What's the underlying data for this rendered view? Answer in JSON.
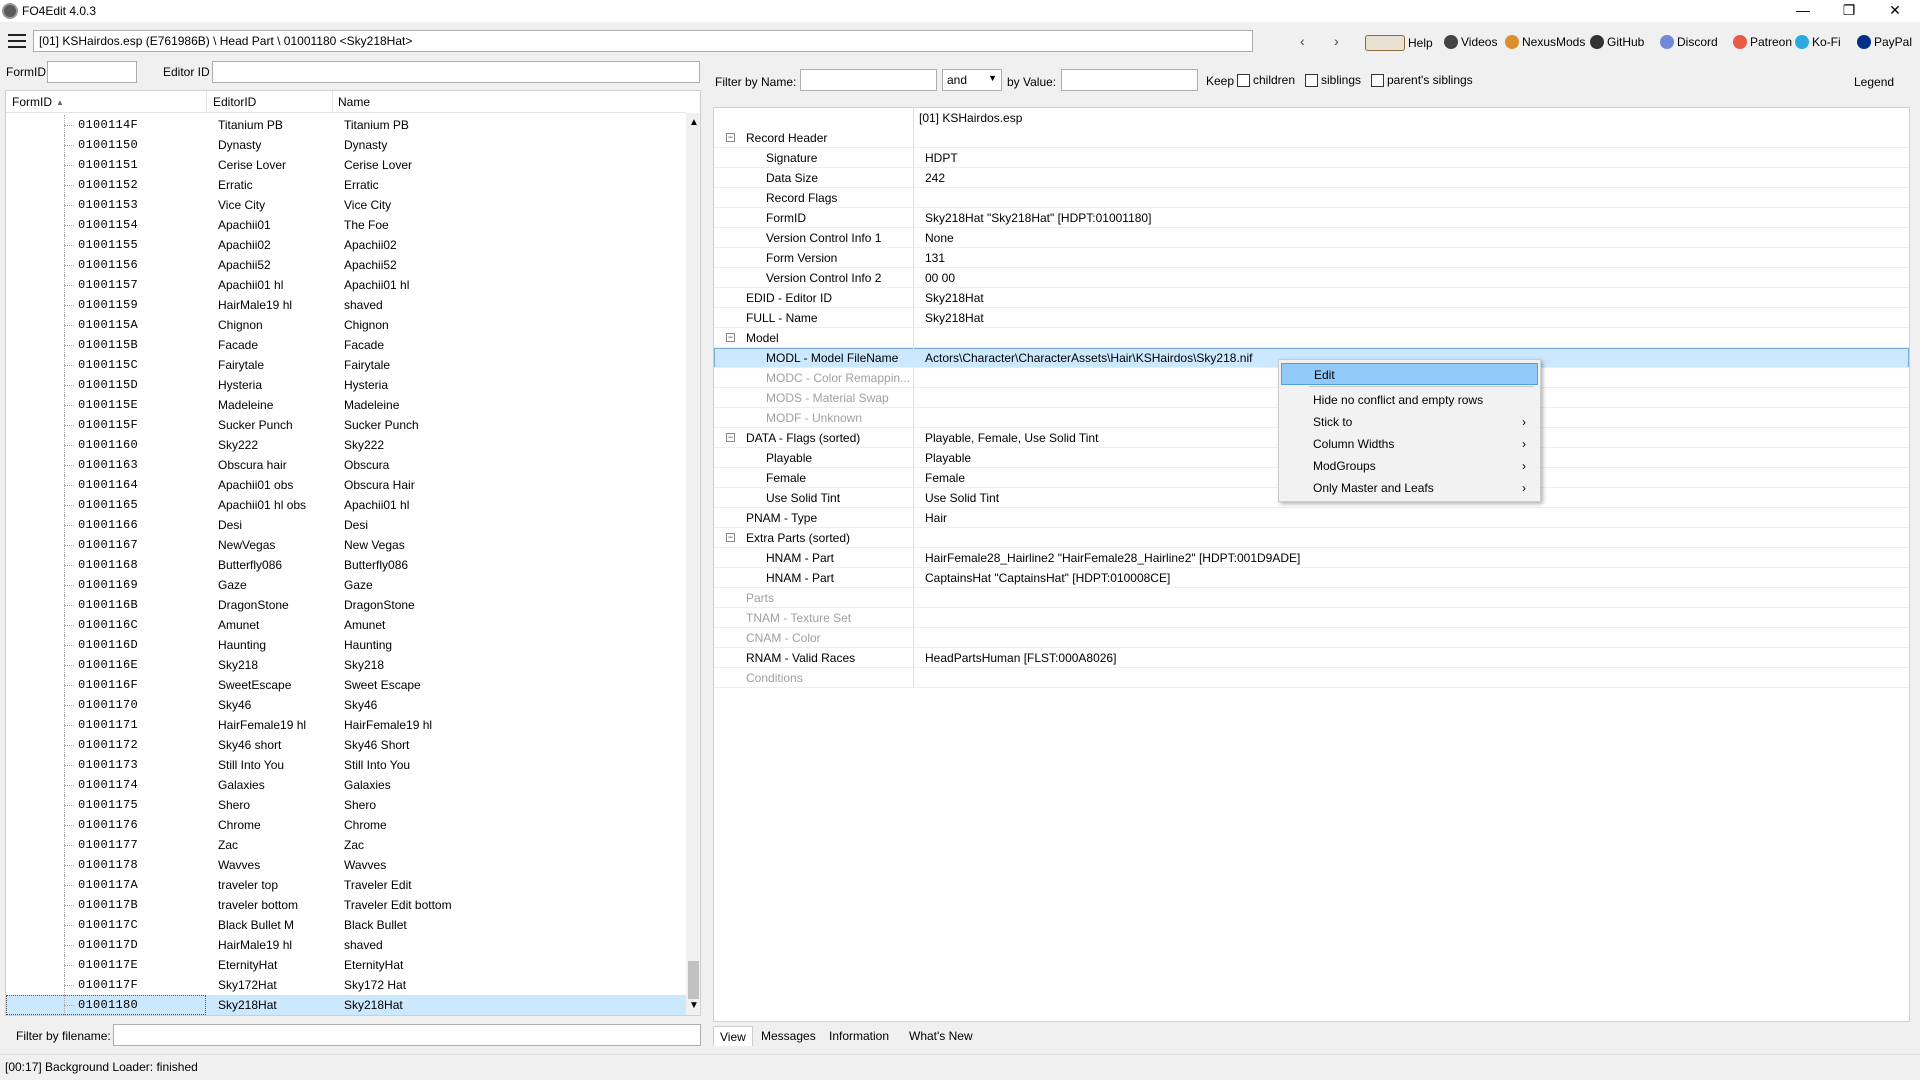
{
  "window": {
    "title": "FO4Edit 4.0.3",
    "minimize": "—",
    "maximize": "❐",
    "close": "✕"
  },
  "toolbar": {
    "path": "[01] KSHairdos.esp (E761986B) \\ Head Part \\ 01001180 <Sky218Hat>",
    "back": "‹",
    "forward": "›",
    "links": [
      {
        "label": "Help",
        "icon": "book-icon",
        "color": "#8a6a3a"
      },
      {
        "label": "Videos",
        "icon": "video-icon",
        "color": "#444"
      },
      {
        "label": "NexusMods",
        "icon": "nexusmods-icon",
        "color": "#d98f2b"
      },
      {
        "label": "GitHub",
        "icon": "github-icon",
        "color": "#333"
      },
      {
        "label": "Discord",
        "icon": "discord-icon",
        "color": "#7289da"
      },
      {
        "label": "Patreon",
        "icon": "patreon-icon",
        "color": "#e85b46"
      },
      {
        "label": "Ko-Fi",
        "icon": "kofi-icon",
        "color": "#29abe0"
      },
      {
        "label": "PayPal",
        "icon": "paypal-icon",
        "color": "#003087"
      }
    ]
  },
  "left": {
    "formid_label": "FormID",
    "editorid_label": "Editor ID",
    "columns": [
      "FormID",
      "EditorID",
      "Name"
    ],
    "sort_arrow": "▲",
    "rows": [
      [
        "0100114F",
        "Titanium PB",
        "Titanium PB"
      ],
      [
        "01001150",
        "Dynasty",
        "Dynasty"
      ],
      [
        "01001151",
        "Cerise Lover",
        "Cerise Lover"
      ],
      [
        "01001152",
        "Erratic",
        "Erratic"
      ],
      [
        "01001153",
        "Vice City",
        "Vice City"
      ],
      [
        "01001154",
        "Apachii01",
        "The Foe"
      ],
      [
        "01001155",
        "Apachii02",
        "Apachii02"
      ],
      [
        "01001156",
        "Apachii52",
        "Apachii52"
      ],
      [
        "01001157",
        "Apachii01 hl",
        "Apachii01 hl"
      ],
      [
        "01001159",
        "HairMale19 hl",
        "shaved"
      ],
      [
        "0100115A",
        "Chignon",
        "Chignon"
      ],
      [
        "0100115B",
        "Facade",
        "Facade"
      ],
      [
        "0100115C",
        "Fairytale",
        "Fairytale"
      ],
      [
        "0100115D",
        "Hysteria",
        "Hysteria"
      ],
      [
        "0100115E",
        "Madeleine",
        "Madeleine"
      ],
      [
        "0100115F",
        "Sucker Punch",
        "Sucker Punch"
      ],
      [
        "01001160",
        "Sky222",
        "Sky222"
      ],
      [
        "01001163",
        "Obscura hair",
        "Obscura"
      ],
      [
        "01001164",
        "Apachii01 obs",
        "Obscura Hair"
      ],
      [
        "01001165",
        "Apachii01 hl obs",
        "Apachii01 hl"
      ],
      [
        "01001166",
        "Desi",
        "Desi"
      ],
      [
        "01001167",
        "NewVegas",
        "New Vegas"
      ],
      [
        "01001168",
        "Butterfly086",
        "Butterfly086"
      ],
      [
        "01001169",
        "Gaze",
        "Gaze"
      ],
      [
        "0100116B",
        "DragonStone",
        "DragonStone"
      ],
      [
        "0100116C",
        "Amunet",
        "Amunet"
      ],
      [
        "0100116D",
        "Haunting",
        "Haunting"
      ],
      [
        "0100116E",
        "Sky218",
        "Sky218"
      ],
      [
        "0100116F",
        "SweetEscape",
        "Sweet Escape"
      ],
      [
        "01001170",
        "Sky46",
        "Sky46"
      ],
      [
        "01001171",
        "HairFemale19 hl",
        "HairFemale19 hl"
      ],
      [
        "01001172",
        "Sky46 short",
        "Sky46 Short"
      ],
      [
        "01001173",
        "Still Into You",
        "Still Into You"
      ],
      [
        "01001174",
        "Galaxies",
        "Galaxies"
      ],
      [
        "01001175",
        "Shero",
        "Shero"
      ],
      [
        "01001176",
        "Chrome",
        "Chrome"
      ],
      [
        "01001177",
        "Zac",
        "Zac"
      ],
      [
        "01001178",
        "Wavves",
        "Wavves"
      ],
      [
        "0100117A",
        "traveler top",
        "Traveler Edit"
      ],
      [
        "0100117B",
        "traveler bottom",
        "Traveler Edit bottom"
      ],
      [
        "0100117C",
        "Black Bullet M",
        "Black Bullet"
      ],
      [
        "0100117D",
        "HairMale19 hl",
        "shaved"
      ],
      [
        "0100117E",
        "EternityHat",
        "EternityHat"
      ],
      [
        "0100117F",
        "Sky172Hat",
        "Sky172 Hat"
      ],
      [
        "01001180",
        "Sky218Hat",
        "Sky218Hat"
      ]
    ],
    "filter_label": "Filter by filename:"
  },
  "right": {
    "filter_name_label": "Filter by Name:",
    "and_value": "and",
    "by_value_label": "by Value:",
    "keep_label": "Keep",
    "chk_children": "children",
    "chk_siblings": "siblings",
    "chk_parents": "parent's siblings",
    "legend": "Legend",
    "file_header": "[01] KSHairdos.esp",
    "records": [
      {
        "name": "Record Header",
        "value": "",
        "level": 0,
        "toggle": "−"
      },
      {
        "name": "Signature",
        "value": "HDPT",
        "level": 1
      },
      {
        "name": "Data Size",
        "value": "242",
        "level": 1
      },
      {
        "name": "Record Flags",
        "value": "",
        "level": 1
      },
      {
        "name": "FormID",
        "value": "Sky218Hat \"Sky218Hat\" [HDPT:01001180]",
        "level": 1
      },
      {
        "name": "Version Control Info 1",
        "value": "None",
        "level": 1
      },
      {
        "name": "Form Version",
        "value": "131",
        "level": 1
      },
      {
        "name": "Version Control Info 2",
        "value": "00 00",
        "level": 1
      },
      {
        "name": "EDID - Editor ID",
        "value": "Sky218Hat",
        "level": 0
      },
      {
        "name": "FULL - Name",
        "value": "Sky218Hat",
        "level": 0
      },
      {
        "name": "Model",
        "value": "",
        "level": 0,
        "toggle": "−"
      },
      {
        "name": "MODL - Model FileName",
        "value": "Actors\\Character\\CharacterAssets\\Hair\\KSHairdos\\Sky218.nif",
        "level": 1,
        "hl": true
      },
      {
        "name": "MODC - Color Remappin...",
        "value": "",
        "level": 1,
        "gray": true
      },
      {
        "name": "MODS - Material Swap",
        "value": "",
        "level": 1,
        "gray": true
      },
      {
        "name": "MODF - Unknown",
        "value": "",
        "level": 1,
        "gray": true
      },
      {
        "name": "DATA - Flags (sorted)",
        "value": "Playable, Female, Use Solid Tint",
        "level": 0,
        "toggle": "−"
      },
      {
        "name": "Playable",
        "value": "Playable",
        "level": 1
      },
      {
        "name": "Female",
        "value": "Female",
        "level": 1
      },
      {
        "name": "Use Solid Tint",
        "value": "Use Solid Tint",
        "level": 1
      },
      {
        "name": "PNAM - Type",
        "value": "Hair",
        "level": 0
      },
      {
        "name": "Extra Parts (sorted)",
        "value": "",
        "level": 0,
        "toggle": "−"
      },
      {
        "name": "HNAM - Part",
        "value": "HairFemale28_Hairline2 \"HairFemale28_Hairline2\" [HDPT:001D9ADE]",
        "level": 1
      },
      {
        "name": "HNAM - Part",
        "value": "CaptainsHat \"CaptainsHat\" [HDPT:010008CE]",
        "level": 1
      },
      {
        "name": "Parts",
        "value": "",
        "level": 0,
        "gray": true
      },
      {
        "name": "TNAM - Texture Set",
        "value": "",
        "level": 0,
        "gray": true
      },
      {
        "name": "CNAM - Color",
        "value": "",
        "level": 0,
        "gray": true
      },
      {
        "name": "RNAM - Valid Races",
        "value": "HeadPartsHuman [FLST:000A8026]",
        "level": 0
      },
      {
        "name": "Conditions",
        "value": "",
        "level": 0,
        "gray": true
      }
    ],
    "context_menu": {
      "items": [
        {
          "label": "Edit",
          "arrow": ""
        },
        {
          "label": "Hide no conflict and empty rows",
          "arrow": ""
        },
        {
          "label": "Stick to",
          "arrow": "›"
        },
        {
          "label": "Column Widths",
          "arrow": "›"
        },
        {
          "label": "ModGroups",
          "arrow": "›"
        },
        {
          "label": "Only Master and Leafs",
          "arrow": "›"
        }
      ]
    },
    "tabs": [
      "View",
      "Messages",
      "Information",
      "What's New"
    ]
  },
  "status": "[00:17] Background Loader: finished"
}
